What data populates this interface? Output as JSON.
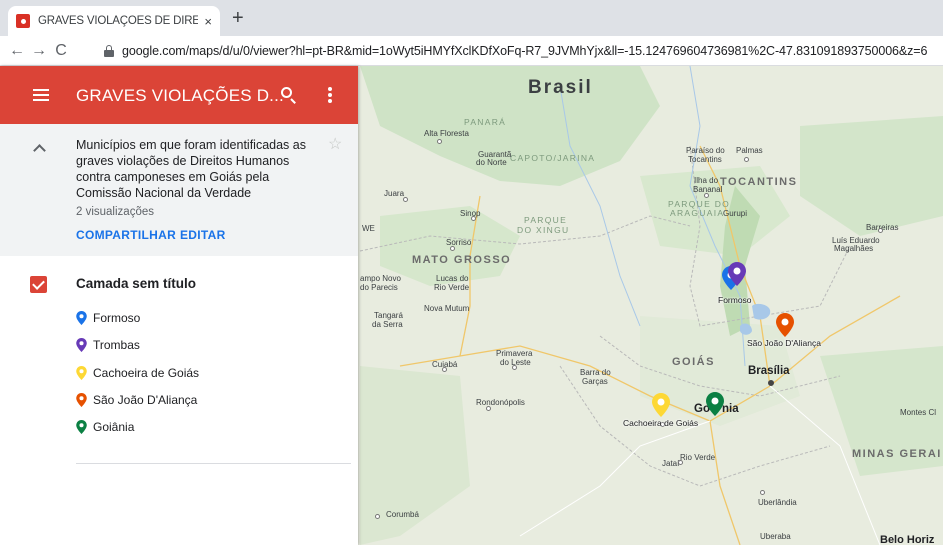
{
  "browser": {
    "tab_title": "GRAVES VIOLAÇÕES DE DIREITOS",
    "tab_close": "×",
    "new_tab": "+",
    "back": "←",
    "forward": "→",
    "reload": "C",
    "url": "google.com/maps/d/u/0/viewer?hl=pt-BR&mid=1oWyt5iHMYfXclKDfXoFq-R7_9JVMhYjx&ll=-15.124769604736981%2C-47.831091893750006&z=6"
  },
  "panel": {
    "title": "GRAVES VIOLAÇÕES D...",
    "description": "Municípios em que foram identificadas as graves violações de Direitos Humanos contra camponeses em Goiás pela Comissão Nacional da Verdade",
    "views": "2 visualizações",
    "share_label": "COMPARTILHAR",
    "edit_label": "EDITAR",
    "star": "☆",
    "layer": {
      "title": "Camada sem título",
      "items": [
        {
          "label": "Formoso",
          "color": "#1a73e8"
        },
        {
          "label": "Trombas",
          "color": "#673ab7"
        },
        {
          "label": "Cachoeira de Goiás",
          "color": "#fdd835"
        },
        {
          "label": "São João D'Aliança",
          "color": "#e65100"
        },
        {
          "label": "Goiânia",
          "color": "#0b8043"
        }
      ]
    }
  },
  "map": {
    "country": "Brasil",
    "states": {
      "mato_grosso": "MATO GROSSO",
      "tocantins": "TOCANTINS",
      "goias": "GOIÁS",
      "minas": "MINAS GERAI"
    },
    "parks": {
      "panara": "PANARÁ",
      "capoto": "CAPOTO/JARINA",
      "xingu_1": "PARQUE",
      "xingu_2": "DO XINGU",
      "araguaia_1": "PARQUE DO",
      "araguaia_2": "ARAGUAIA"
    },
    "cities": {
      "alta_floresta": "Alta Floresta",
      "guaranta_1": "Guarantã",
      "guaranta_2": "do Norte",
      "paraiso_1": "Paraíso do",
      "paraiso_2": "Tocantins",
      "palmas": "Palmas",
      "ilha_1": "Ilha do",
      "ilha_2": "Bananal",
      "gurupi": "Gurupi",
      "juara": "Juara",
      "sinop": "Sinop",
      "barreiras": "Barreiras",
      "luis_1": "Luís Eduardo",
      "luis_2": "Magalhães",
      "we": "WE",
      "sorriso": "Sorriso",
      "campo_1": "ampo Novo",
      "campo_2": "do Parecis",
      "lucas_1": "Lucas do",
      "lucas_2": "Rio Verde",
      "nova_mutum": "Nova Mutum",
      "tangara_1": "Tangará",
      "tangara_2": "da Serra",
      "cuiaba": "Cuiabá",
      "primavera_1": "Primavera",
      "primavera_2": "do Leste",
      "barra_1": "Barra do",
      "barra_2": "Garças",
      "rondonopolis": "Rondonópolis",
      "montes_claros": "Montes Cl",
      "jatai": "Jataí",
      "rio_verde": "Rio Verde",
      "uberlandia": "Uberlândia",
      "corumba": "Corumbá",
      "uberaba": "Uberaba",
      "belo_horiz": "Belo Horiz",
      "brasilia": "Brasília",
      "goiania_a": "Go",
      "goiania_b": "nia"
    },
    "markers": {
      "formoso": "Formoso",
      "sao_joao": "São João D'Aliança",
      "cachoeira": "Cachoeira de Goiás"
    }
  }
}
